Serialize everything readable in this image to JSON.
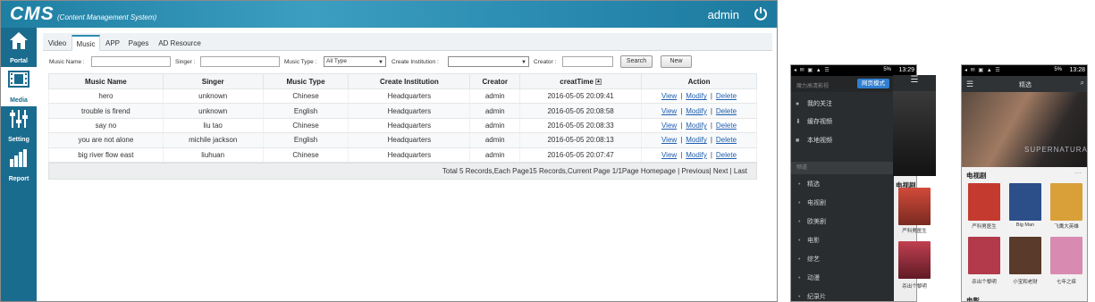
{
  "cms": {
    "logo": "CMS",
    "subtitle": "(Content Management System)",
    "user": "admin",
    "sidebar": [
      {
        "label": "Portal",
        "icon": "home-icon"
      },
      {
        "label": "Media",
        "icon": "film-icon"
      },
      {
        "label": "Setting",
        "icon": "sliders-icon"
      },
      {
        "label": "Report",
        "icon": "bar-chart-icon"
      }
    ],
    "tabs": [
      "Video",
      "Music",
      "APP",
      "Pages",
      "AD Resource"
    ],
    "active_tab": "Music",
    "filters": {
      "music_name_label": "Music Name :",
      "singer_label": "Singer :",
      "music_type_label": "Music Type :",
      "music_type_value": "All Type",
      "institution_label": "Create Institution :",
      "institution_value": "",
      "creator_label": "Creator :",
      "search_button": "Search",
      "new_button": "New"
    },
    "columns": [
      "Music Name",
      "Singer",
      "Music Type",
      "Create Institution",
      "Creator",
      "creatTime",
      "Action"
    ],
    "rows": [
      {
        "name": "hero",
        "singer": "unknown",
        "type": "Chinese",
        "institution": "Headquarters",
        "creator": "admin",
        "time": "2016-05-05 20:09:41"
      },
      {
        "name": "trouble is firend",
        "singer": "unknown",
        "type": "English",
        "institution": "Headquarters",
        "creator": "admin",
        "time": "2016-05-05 20:08:58"
      },
      {
        "name": "say no",
        "singer": "liu tao",
        "type": "Chinese",
        "institution": "Headquarters",
        "creator": "admin",
        "time": "2016-05-05 20:08:33"
      },
      {
        "name": "you are not alone",
        "singer": "michile jackson",
        "type": "English",
        "institution": "Headquarters",
        "creator": "admin",
        "time": "2016-05-05 20:08:13"
      },
      {
        "name": "big river flow east",
        "singer": "liuhuan",
        "type": "Chinese",
        "institution": "Headquarters",
        "creator": "admin",
        "time": "2016-05-05 20:07:47"
      }
    ],
    "actions": {
      "view": "View",
      "modify": "Modify",
      "delete": "Delete"
    },
    "pager": "Total 5 Records,Each Page15 Records,Current Page 1/1Page Homepage | Previous| Next | Last"
  },
  "phone1": {
    "time": "13:29",
    "battery": "5%",
    "top_title": "魔力高清影视",
    "mode_button": "网页模式",
    "menu_items": [
      {
        "label": "我的关注",
        "icon": "user-icon"
      },
      {
        "label": "缓存视频",
        "icon": "download-icon"
      },
      {
        "label": "本地视频",
        "icon": "folder-icon"
      }
    ],
    "section_label": "频道",
    "categories": [
      "精选",
      "电视剧",
      "欧美剧",
      "电影",
      "综艺",
      "动漫",
      "纪录片"
    ],
    "right_section": "电视剧",
    "posters": [
      "严科男医生",
      "杀出个黎明"
    ]
  },
  "phone2": {
    "time": "13:28",
    "battery": "5%",
    "title": "精选",
    "banner_text": "SUPERNATURAL",
    "section": "电视剧",
    "section2": "电影",
    "more": "···",
    "posters": [
      "严科男医生",
      "Big Man",
      "飞鹰大英雄",
      "杀出个黎明",
      "小宝和老财",
      "七年之痒"
    ],
    "poster_colors": [
      "#c53a2e",
      "#2c4f8a",
      "#d9a03a",
      "#b23a4a",
      "#5a3a2a",
      "#d98ab0"
    ]
  }
}
